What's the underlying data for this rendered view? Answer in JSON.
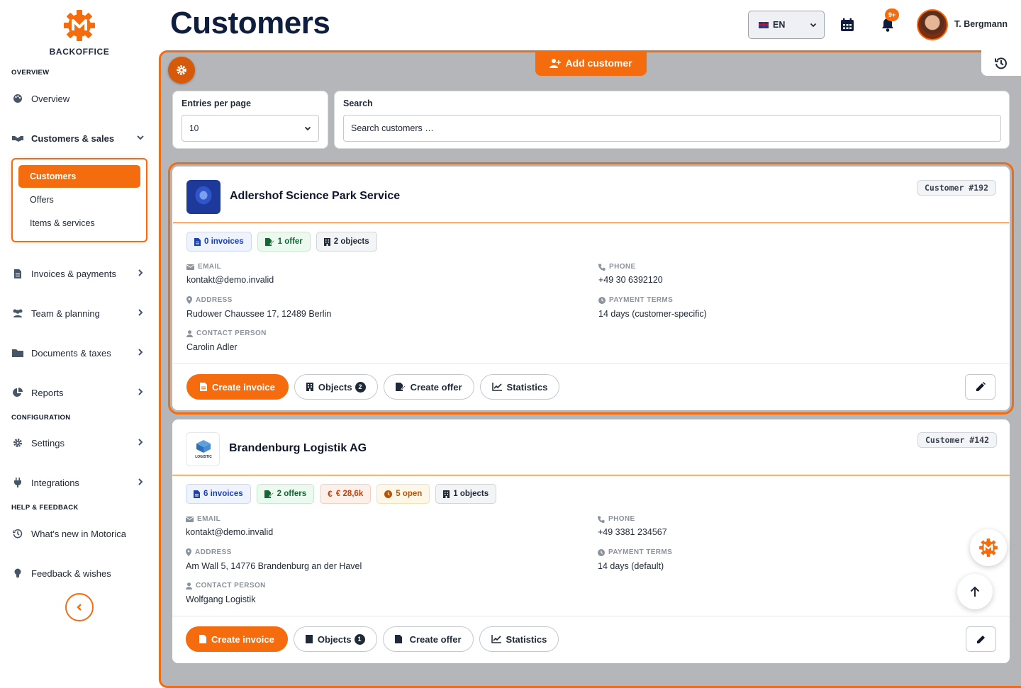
{
  "sidebar": {
    "brand": "BACKOFFICE",
    "sections": {
      "overview": "OVERVIEW",
      "configuration": "CONFIGURATION",
      "help": "HELP & FEEDBACK"
    },
    "items": {
      "overview": "Overview",
      "customers_sales": "Customers & sales",
      "invoices": "Invoices & payments",
      "team": "Team & planning",
      "documents": "Documents & taxes",
      "reports": "Reports",
      "settings": "Settings",
      "integrations": "Integrations",
      "whats_new": "What's new in Motorica",
      "feedback": "Feedback & wishes"
    },
    "subitems": {
      "customers": "Customers",
      "offers": "Offers",
      "items_services": "Items & services"
    }
  },
  "header": {
    "title": "Customers",
    "language": "EN",
    "notifications_badge": "9+",
    "user_name": "T. Bergmann"
  },
  "toolbar": {
    "add_customer": "Add customer"
  },
  "filters": {
    "entries_label": "Entries per page",
    "entries_value": "10",
    "search_label": "Search",
    "search_placeholder": "Search customers …"
  },
  "field_labels": {
    "email": "EMAIL",
    "phone": "PHONE",
    "address": "ADDRESS",
    "payment_terms": "PAYMENT TERMS",
    "contact_person": "CONTACT PERSON"
  },
  "actions": {
    "create_invoice": "Create invoice",
    "objects": "Objects",
    "create_offer": "Create offer",
    "statistics": "Statistics"
  },
  "customers": [
    {
      "name": "Adlershof Science Park Service",
      "id_label": "Customer #192",
      "badges": {
        "invoices": "0 invoices",
        "offers": "1 offer",
        "objects": "2 objects"
      },
      "email": "kontakt@demo.invalid",
      "phone": "+49 30 6392120",
      "address": "Rudower Chaussee 17, 12489 Berlin",
      "payment_terms": "14 days (customer-specific)",
      "contact_person": "Carolin Adler",
      "objects_count": "2"
    },
    {
      "name": "Brandenburg Logistik AG",
      "id_label": "Customer #142",
      "logo_text": "LOGISTIC",
      "badges": {
        "invoices": "6 invoices",
        "offers": "2 offers",
        "amount": "€ 28,6k",
        "open": "5 open",
        "objects": "1 objects"
      },
      "email": "kontakt@demo.invalid",
      "phone": "+49 3381 234567",
      "address": "Am Wall 5, 14776 Brandenburg an der Havel",
      "payment_terms": "14 days (default)",
      "contact_person": "Wolfgang Logistik",
      "objects_count": "1"
    }
  ],
  "colors": {
    "accent": "#f46c0e",
    "title": "#0f1e3d",
    "backdrop": "#b4b6b9"
  }
}
